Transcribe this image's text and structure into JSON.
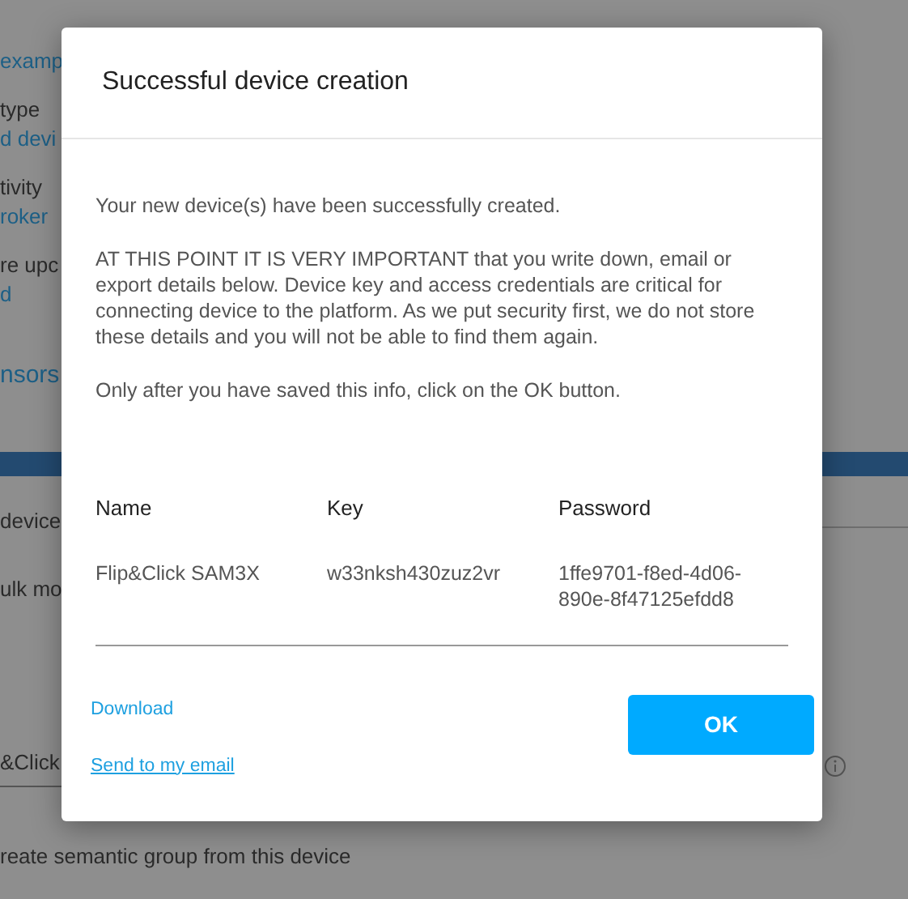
{
  "background": {
    "fragments": [
      {
        "text": "examp",
        "kind": "link"
      },
      {
        "text": "type",
        "kind": "label"
      },
      {
        "text": "d devi",
        "kind": "link"
      },
      {
        "text": "tivity",
        "kind": "label"
      },
      {
        "text": "roker",
        "kind": "link"
      },
      {
        "text": "re upc",
        "kind": "label"
      },
      {
        "text": "d",
        "kind": "link"
      },
      {
        "text": "nsors",
        "kind": "heading"
      }
    ],
    "section_label": "device",
    "option_label": "ulk mo",
    "field_value": "&Click",
    "checkbox_label": "reate semantic group from this device"
  },
  "dialog": {
    "title": "Successful device creation",
    "paragraphs": [
      "Your new device(s) have been successfully created.",
      "AT THIS POINT IT IS VERY IMPORTANT that you write down, email or export details below. Device key and access credentials are critical for connecting device to the platform. As we put security first, we do not store these details and you will not be able to find them again.",
      "Only after you have saved this info, click on the OK button."
    ],
    "table": {
      "columns": [
        "Name",
        "Key",
        "Password"
      ],
      "rows": [
        [
          "Flip&Click SAM3X",
          "w33nksh430zuz2vr",
          "1ffe9701-f8ed-4d06-890e-8f47125efdd8"
        ]
      ]
    },
    "links": [
      "Download",
      "Send to my email"
    ],
    "ok_button": "OK"
  }
}
